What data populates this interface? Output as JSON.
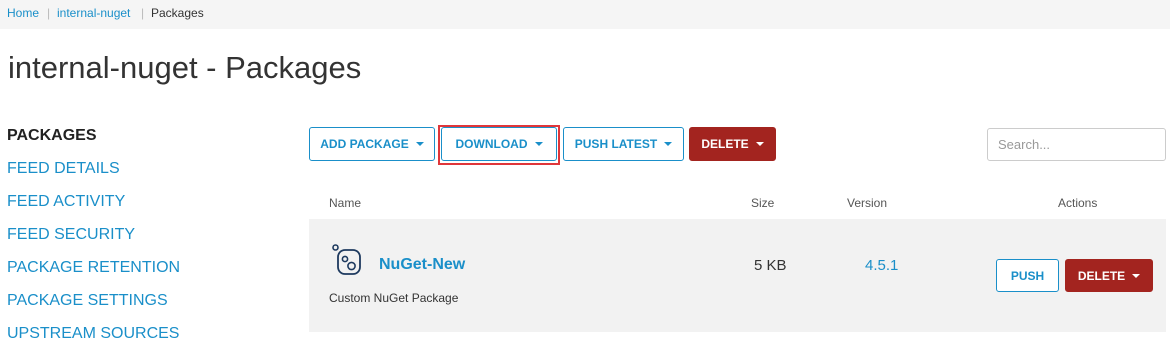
{
  "breadcrumb": {
    "items": [
      "Home",
      "internal-nuget",
      "Packages"
    ],
    "separator": "|"
  },
  "page": {
    "title": "internal-nuget - Packages"
  },
  "sidebar": {
    "items": [
      {
        "label": "PACKAGES",
        "active": true
      },
      {
        "label": "FEED DETAILS",
        "active": false
      },
      {
        "label": "FEED ACTIVITY",
        "active": false
      },
      {
        "label": "FEED SECURITY",
        "active": false
      },
      {
        "label": "PACKAGE RETENTION",
        "active": false
      },
      {
        "label": "PACKAGE SETTINGS",
        "active": false
      },
      {
        "label": "UPSTREAM SOURCES",
        "active": false
      }
    ]
  },
  "toolbar": {
    "add_package": "ADD PACKAGE",
    "download": "DOWNLOAD",
    "push_latest": "PUSH LATEST",
    "delete": "DELETE",
    "highlighted_button": "DOWNLOAD"
  },
  "search": {
    "placeholder": "Search...",
    "value": ""
  },
  "table": {
    "headers": {
      "name": "Name",
      "size": "Size",
      "version": "Version",
      "actions": "Actions"
    },
    "rows": [
      {
        "icon": "nuget-package-icon",
        "name": "NuGet-New",
        "description": "Custom NuGet Package",
        "size": "5 KB",
        "version": "4.5.1",
        "push_label": "PUSH",
        "delete_label": "DELETE"
      }
    ]
  },
  "colors": {
    "accent": "#1a8fc9",
    "danger": "#a3241f",
    "highlight": "#e0363a",
    "row_bg": "#f2f2f2",
    "crumb_bg": "#f5f5f5"
  }
}
